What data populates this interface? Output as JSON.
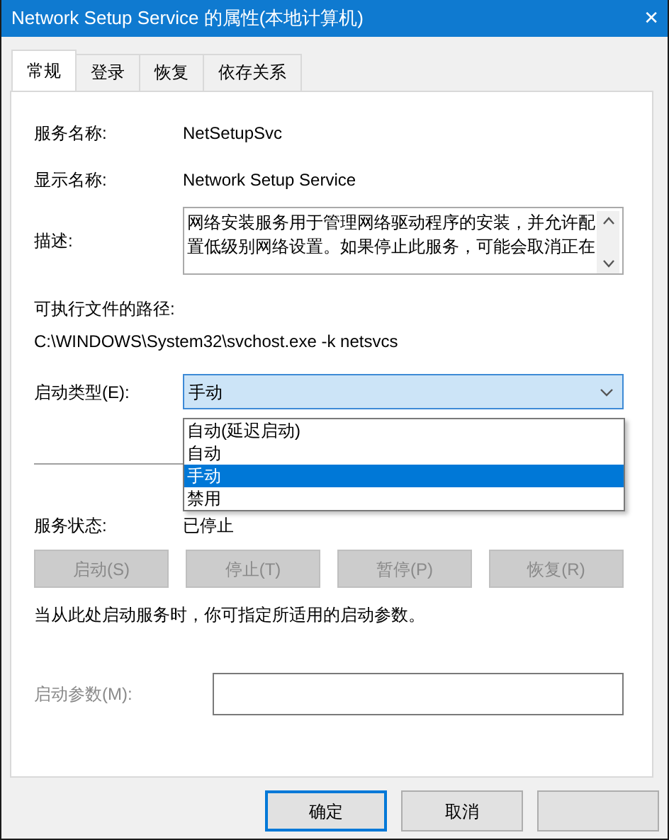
{
  "window": {
    "title": "Network Setup Service 的属性(本地计算机)",
    "close": "✕"
  },
  "tabs": [
    {
      "label": "常规",
      "selected": true
    },
    {
      "label": "登录",
      "selected": false
    },
    {
      "label": "恢复",
      "selected": false
    },
    {
      "label": "依存关系",
      "selected": false
    }
  ],
  "fields": [
    {
      "label": "服务名称:",
      "value": "NetSetupSvc"
    },
    {
      "label": "显示名称:",
      "value": "Network Setup Service"
    }
  ],
  "description": {
    "label": "描述:",
    "text": "网络安装服务用于管理网络驱动程序的安装，并允许配置低级别网络设置。如果停止此服务，可能会取消正在"
  },
  "path": {
    "label": "可执行文件的路径:",
    "value": "C:\\WINDOWS\\System32\\svchost.exe -k netsvcs"
  },
  "startup_type": {
    "label": "启动类型(E):",
    "value": "手动",
    "expanded": true,
    "options": [
      {
        "label": "自动(延迟启动)",
        "selected": false
      },
      {
        "label": "自动",
        "selected": false
      },
      {
        "label": "手动",
        "selected": true
      },
      {
        "label": "禁用",
        "selected": false
      }
    ]
  },
  "service_status": {
    "label": "服务状态:",
    "value": "已停止"
  },
  "service_buttons": [
    {
      "label": "启动(S)",
      "disabled": true
    },
    {
      "label": "停止(T)",
      "disabled": true
    },
    {
      "label": "暂停(P)",
      "disabled": true
    },
    {
      "label": "恢复(R)",
      "disabled": true
    }
  ],
  "hint": "当从此处启动服务时，你可指定所适用的启动参数。",
  "start_params": {
    "label": "启动参数(M):",
    "disabled": true
  },
  "dialog_buttons": [
    {
      "label": "确定",
      "default": true
    },
    {
      "label": "取消",
      "default": false
    },
    {
      "default": false
    }
  ]
}
